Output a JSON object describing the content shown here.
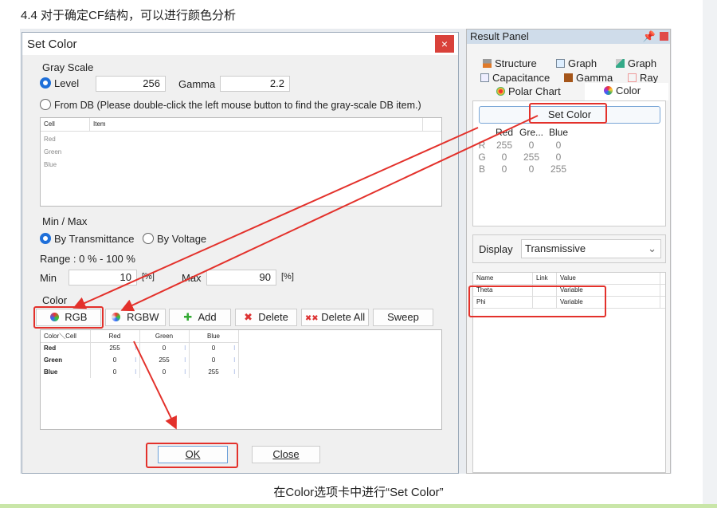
{
  "heading": "4.4 对于确定CF结构，可以进行颜色分析",
  "caption": "在Color选项卡中进行“Set Color”",
  "dialog": {
    "title": "Set Color",
    "close": "×",
    "gray_scale": {
      "title": "Gray Scale",
      "level_label": "Level",
      "level": "256",
      "gamma_label": "Gamma",
      "gamma": "2.2",
      "from_db": "From DB (Please double-click the left mouse button to find the gray-scale DB item.)",
      "grid_headers": [
        "Cell",
        "Item"
      ],
      "grid_rows": [
        "Red",
        "Green",
        "Blue"
      ]
    },
    "minmax": {
      "title": "Min / Max",
      "by_trans": "By Transmittance",
      "by_volt": "By Voltage",
      "range": "Range : 0 % - 100 %",
      "min_label": "Min",
      "min": "10",
      "unit": "[%]",
      "max_label": "Max",
      "max": "90"
    },
    "color": {
      "title": "Color",
      "buttons": [
        "RGB",
        "RGBW",
        "Add",
        "Delete",
        "Delete All",
        "Sweep"
      ],
      "headers": [
        "Color＼Cell",
        "Red",
        "Green",
        "Blue"
      ],
      "rows": [
        [
          "Red",
          "255",
          "0",
          "0"
        ],
        [
          "Green",
          "0",
          "255",
          "0"
        ],
        [
          "Blue",
          "0",
          "0",
          "255"
        ]
      ]
    },
    "ok": "OK",
    "close_btn": "Close"
  },
  "result_panel": {
    "title": "Result Panel",
    "tabs": [
      "Structure",
      "Graph",
      "Graph",
      "Capacitance",
      "Gamma",
      "Ray",
      "Polar Chart",
      "Color"
    ],
    "set_color": "Set Color",
    "table_headers": [
      "Red",
      "Gre...",
      "Blue"
    ],
    "rows": [
      [
        "R",
        "255",
        "0",
        "0"
      ],
      [
        "G",
        "0",
        "255",
        "0"
      ],
      [
        "B",
        "0",
        "0",
        "255"
      ]
    ],
    "display_label": "Display",
    "display_value": "Transmissive",
    "param_headers": [
      "Name",
      "Link",
      "Value"
    ],
    "params": [
      [
        "Theta",
        "",
        "Variable"
      ],
      [
        "Phi",
        "",
        "Variable"
      ]
    ]
  },
  "colors": {
    "accent": "#1e6fd9",
    "highlight": "#e3312b"
  }
}
